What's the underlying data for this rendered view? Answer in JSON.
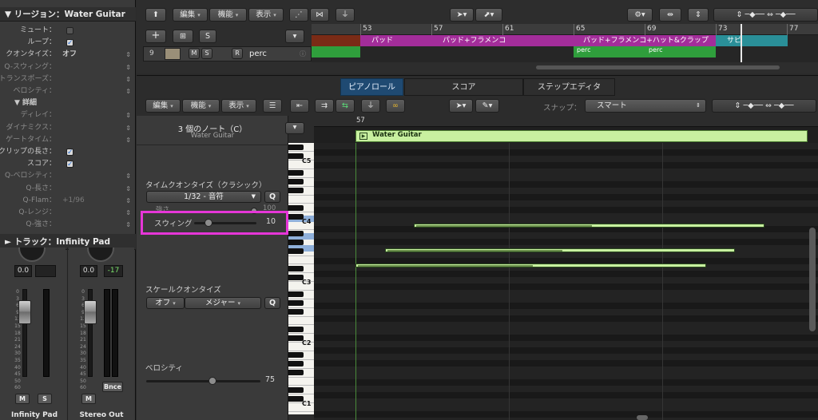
{
  "inspector": {
    "region_header": "▼ リージョン：Water Guitar",
    "rows": [
      {
        "label": "ミュート：",
        "value": "",
        "type": "check",
        "checked": false,
        "dim": false
      },
      {
        "label": "ループ：",
        "value": "✓",
        "type": "check",
        "checked": true,
        "dim": false
      },
      {
        "label": "クオンタイズ：",
        "value": "オフ",
        "type": "value",
        "dim": false,
        "bold": true
      },
      {
        "label": "Q-スウィング：",
        "value": "",
        "type": "value",
        "dim": true
      },
      {
        "label": "トランスポーズ：",
        "value": "",
        "type": "value",
        "dim": true
      },
      {
        "label": "ベロシティ：",
        "value": "",
        "type": "value",
        "dim": true
      },
      {
        "label": "▼ 詳細",
        "value": "",
        "type": "section",
        "dim": false
      },
      {
        "label": "ディレイ：",
        "value": "",
        "type": "value",
        "dim": true
      },
      {
        "label": "ダイナミクス：",
        "value": "",
        "type": "value",
        "dim": true
      },
      {
        "label": "ゲートタイム：",
        "value": "",
        "type": "value",
        "dim": true
      },
      {
        "label": "クリップの長さ：",
        "value": "✓",
        "type": "check",
        "checked": true,
        "dim": false
      },
      {
        "label": "スコア：",
        "value": "✓",
        "type": "check",
        "checked": true,
        "dim": false
      },
      {
        "label": "Q-ベロシティ：",
        "value": "",
        "type": "value",
        "dim": true
      },
      {
        "label": "Q-長さ：",
        "value": "",
        "type": "value",
        "dim": true
      },
      {
        "label": "Q-Flam：",
        "value": "+1/96",
        "type": "value",
        "dim": true
      },
      {
        "label": "Q-レンジ：",
        "value": "",
        "type": "value",
        "dim": true
      },
      {
        "label": "Q-強さ：",
        "value": "",
        "type": "value",
        "dim": true
      }
    ],
    "track_header": "► トラック：Infinity Pad",
    "strip1": {
      "value": "0.0",
      "name": "Infinity Pad",
      "mute": "M",
      "solo": "S"
    },
    "strip2": {
      "value": "0.0",
      "peak": "-17",
      "name": "Stereo Out",
      "mute": "M",
      "bnce": "Bnce"
    },
    "scale_marks": [
      "0",
      "3",
      "6",
      "9",
      "12",
      "15",
      "18",
      "21",
      "24",
      "30",
      "35",
      "40",
      "45",
      "50",
      "60"
    ]
  },
  "toolbar": {
    "edit": "編集",
    "functions": "機能",
    "view": "表示"
  },
  "track": {
    "number": "9",
    "mute": "M",
    "solo": "S",
    "record": "R",
    "name": "perc",
    "add": "+",
    "s_btn": "S"
  },
  "ruler_top": [
    "53",
    "57",
    "61",
    "65",
    "69",
    "73",
    "77"
  ],
  "regions": [
    {
      "label": "パッド",
      "color": "#a32d9a"
    },
    {
      "label": "パッド+フラメンコ",
      "color": "#a32d9a"
    },
    {
      "label": "パッド+フラメンコ+ハット&クラップ",
      "color": "#a32d9a"
    },
    {
      "label": "サピ",
      "color": "#2a8f98"
    },
    {
      "label": "perc",
      "color": "#2f9e3c"
    },
    {
      "label": "perc",
      "color": "#2f9e3c"
    }
  ],
  "tabs": [
    "ピアノロール",
    "スコア",
    "ステップエディタ"
  ],
  "editor_toolbar": {
    "edit": "編集",
    "functions": "機能",
    "view": "表示",
    "snap_label": "スナップ：",
    "snap_value": "スマート"
  },
  "left_panel": {
    "note_count": "3 個のノート（C）",
    "track_name": "Water Guitar",
    "time_quantize_label": "タイムクオンタイズ（クラシック）",
    "quantize_value": "1/32 - 音符",
    "q_button": "Q",
    "strength_label": "強さ",
    "strength_value": "100",
    "swing_label": "スウィング",
    "swing_value": "10",
    "scale_quantize_label": "スケールクオンタイズ",
    "scale_off": "オフ",
    "scale_major": "メジャー",
    "scale_q": "Q",
    "velocity_label": "ベロシティ",
    "velocity_value": "75"
  },
  "piano_roll": {
    "bar_label": "57",
    "region_name": "Water Guitar",
    "key_labels": [
      "C5",
      "C4",
      "C3",
      "C2",
      "C1"
    ],
    "notes": [
      {
        "pitch": "C4",
        "start_beat": 1.25,
        "length_beats": 7.5
      },
      {
        "pitch": "A3",
        "start_beat": 0.625,
        "length_beats": 7.5
      },
      {
        "pitch": "G3",
        "start_beat": 0.0,
        "length_beats": 7.5
      }
    ]
  },
  "colors": {
    "accent": "#1f4a72",
    "note": "#c8f0a0",
    "region": "#c8f0a0",
    "highlight": "#e636d8"
  }
}
